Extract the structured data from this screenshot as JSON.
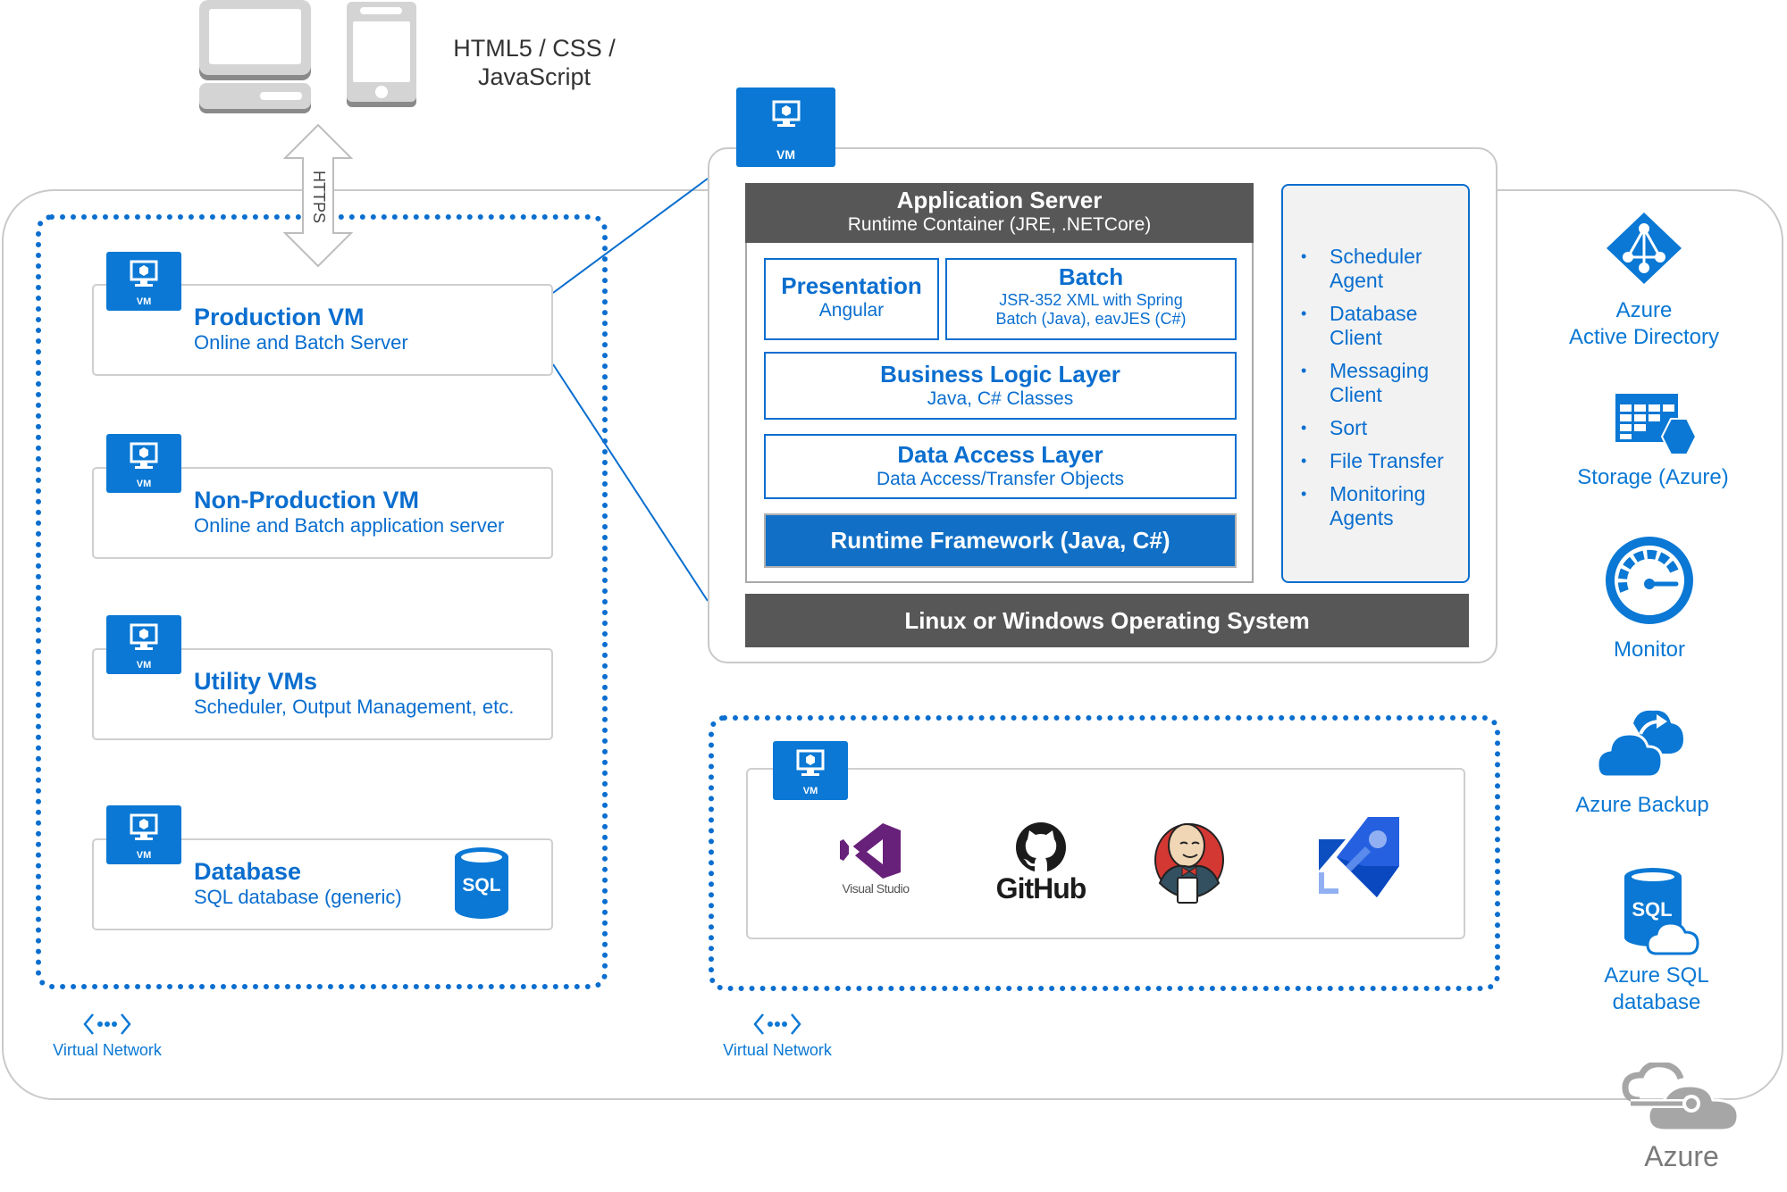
{
  "client": {
    "tech_line1": "HTML5 / CSS /",
    "tech_line2": "JavaScript",
    "protocol": "HTTPS",
    "icons": [
      "desktop-computer-icon",
      "mobile-phone-icon"
    ]
  },
  "vm_badge_label": "VM",
  "left_network": {
    "label": "Virtual Network",
    "vms": [
      {
        "title": "Production VM",
        "subtitle": "Online and Batch Server"
      },
      {
        "title": "Non-Production VM",
        "subtitle": "Online and Batch application server"
      },
      {
        "title": "Utility VMs",
        "subtitle": "Scheduler, Output Management, etc."
      },
      {
        "title": "Database",
        "subtitle": "SQL database (generic)",
        "icon_text": "SQL"
      }
    ]
  },
  "app_server": {
    "header_title": "Application Server",
    "header_subtitle": "Runtime Container (JRE, .NETCore)",
    "presentation": {
      "title": "Presentation",
      "subtitle": "Angular"
    },
    "batch": {
      "title": "Batch",
      "subtitle_line1": "JSR-352 XML with Spring",
      "subtitle_line2": "Batch (Java), eavJES (C#)"
    },
    "business_logic": {
      "title": "Business Logic Layer",
      "subtitle": "Java, C# Classes"
    },
    "data_access": {
      "title": "Data Access Layer",
      "subtitle": "Data Access/Transfer Objects"
    },
    "runtime": {
      "title": "Runtime Framework (Java, C#)"
    },
    "os": {
      "title": "Linux or Windows Operating System"
    },
    "agents": [
      "Scheduler Agent",
      "Database Client",
      "Messaging Client",
      "Sort",
      "File Transfer",
      "Monitoring Agents"
    ]
  },
  "devops_network": {
    "label": "Virtual Network",
    "tools": [
      {
        "name": "Visual Studio",
        "icon": "visual-studio-icon"
      },
      {
        "name": "GitHub",
        "icon": "github-icon"
      },
      {
        "name": "Jenkins",
        "icon": "jenkins-icon"
      },
      {
        "name": "Azure Pipelines",
        "icon": "azure-pipelines-icon"
      }
    ]
  },
  "azure_services": [
    {
      "line1": "Azure",
      "line2": "Active Directory",
      "icon": "azure-active-directory-icon"
    },
    {
      "line1": "Storage (Azure)",
      "line2": "",
      "icon": "storage-icon"
    },
    {
      "line1": "Monitor",
      "line2": "",
      "icon": "monitor-gauge-icon"
    },
    {
      "line1": "Azure Backup",
      "line2": "",
      "icon": "azure-backup-icon"
    },
    {
      "line1": "Azure SQL",
      "line2": "database",
      "icon": "azure-sql-icon",
      "icon_text": "SQL"
    }
  ],
  "azure_brand": {
    "label": "Azure"
  },
  "colors": {
    "accent_blue": "#0a6ecf",
    "icon_blue": "#0a78d4",
    "header_dark": "#575757",
    "panel_gray": "#f2f2f2",
    "border_gray": "#c9c9c9",
    "visual_studio_purple": "#68217a",
    "jenkins_red": "#d33833"
  }
}
